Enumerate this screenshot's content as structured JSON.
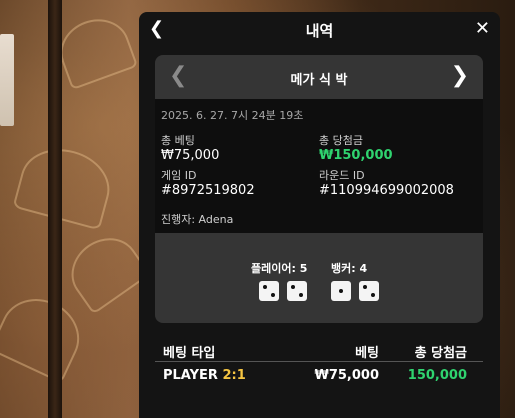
{
  "header": {
    "title": "내역"
  },
  "card": {
    "game_name": "메가 식 박",
    "timestamp": "2025. 6. 27. 7시 24분 19초",
    "total_bet_label": "총 베팅",
    "total_bet_value": "₩75,000",
    "total_win_label": "총 당첨금",
    "total_win_value": "₩150,000",
    "game_id_label": "게임 ID",
    "game_id_value": "#8972519802",
    "round_id_label": "라운드 ID",
    "round_id_value": "#110994699002008",
    "host": "진행자: Adena",
    "player_label": "플레이어: 5",
    "banker_label": "뱅커: 4",
    "player_dice": [
      2,
      2
    ],
    "banker_dice": [
      1,
      2
    ]
  },
  "table": {
    "headers": {
      "type": "베팅 타입",
      "bet": "베팅",
      "win": "총 당첨금"
    },
    "rows": [
      {
        "type": "PLAYER",
        "odds": "2:1",
        "bet": "₩75,000",
        "win": "150,000"
      }
    ]
  },
  "colors": {
    "win_green": "#2fd36f",
    "odds_yellow": "#f5c542"
  }
}
